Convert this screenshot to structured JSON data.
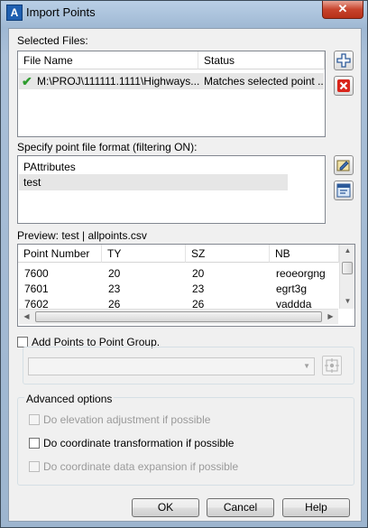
{
  "window": {
    "title": "Import Points",
    "close_glyph": "✕"
  },
  "selected_files": {
    "label": "Selected Files:",
    "columns": [
      "File Name",
      "Status"
    ],
    "rows": [
      {
        "file_name": "M:\\PROJ\\111111.1111\\Highways...",
        "status": "Matches selected point ..."
      }
    ]
  },
  "format": {
    "label": "Specify point file format (filtering ON):",
    "items": [
      "PAttributes",
      "test"
    ],
    "selected": "test"
  },
  "preview": {
    "label": "Preview: test | allpoints.csv",
    "columns": [
      "Point Number",
      "TY",
      "SZ",
      "NB"
    ],
    "rows": [
      [
        "7600",
        "20",
        "20",
        "reoeorgng"
      ],
      [
        "7601",
        "23",
        "23",
        "egrt3g"
      ],
      [
        "7602",
        "26",
        "26",
        "vaddda"
      ]
    ]
  },
  "point_group": {
    "checkbox_label": "Add Points to Point Group.",
    "checked": false,
    "dropdown_value": ""
  },
  "advanced": {
    "title": "Advanced options",
    "options": [
      {
        "label": "Do elevation adjustment if possible",
        "enabled": false,
        "checked": false
      },
      {
        "label": "Do coordinate transformation if possible",
        "enabled": true,
        "checked": false
      },
      {
        "label": "Do coordinate data expansion if possible",
        "enabled": false,
        "checked": false
      }
    ]
  },
  "buttons": {
    "ok": "OK",
    "cancel": "Cancel",
    "help": "Help"
  },
  "icons": [
    "add-file-icon",
    "remove-file-icon",
    "edit-format-icon",
    "manage-format-icon",
    "point-group-picker-icon",
    "check-icon"
  ],
  "colors": {
    "titlebar": "#a9bfd8",
    "close": "#c7432c",
    "remove_red": "#d9261c",
    "add_blue": "#2c5a9a",
    "check_green": "#2e9c2e"
  }
}
